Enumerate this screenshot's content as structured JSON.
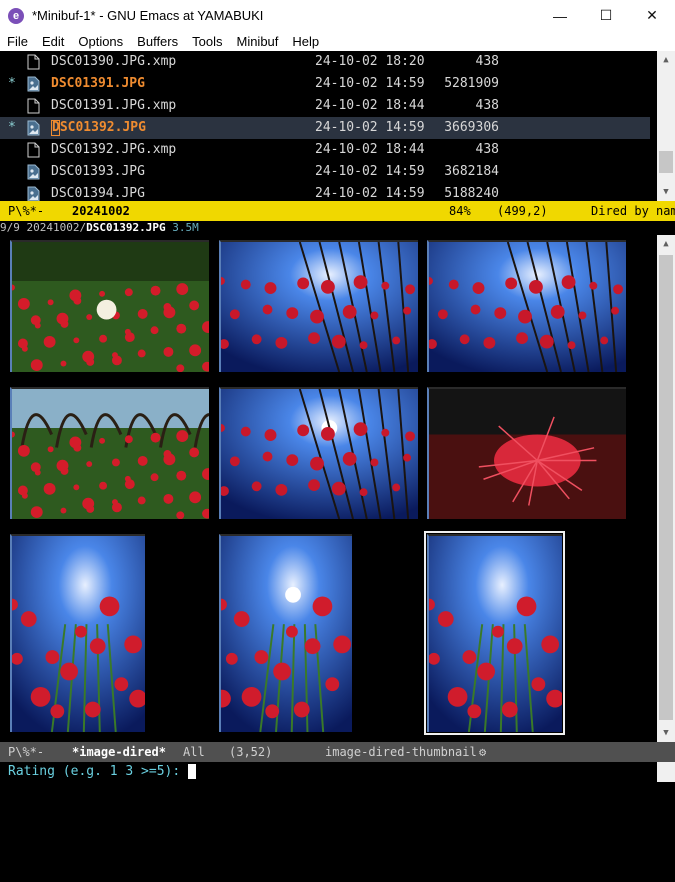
{
  "window": {
    "title": "*Minibuf-1* - GNU Emacs at YAMABUKI",
    "app_icon": "emacs-icon",
    "buttons": {
      "minimize": "—",
      "maximize": "☐",
      "close": "✕"
    }
  },
  "menu": [
    "File",
    "Edit",
    "Options",
    "Buffers",
    "Tools",
    "Minibuf",
    "Help"
  ],
  "dired": {
    "rows": [
      {
        "mark": "",
        "icon": "document-icon",
        "name": "DSC01390.JPG.xmp",
        "date": "24-10-02 18:20",
        "size": "438",
        "marked": false,
        "current": false
      },
      {
        "mark": "*",
        "icon": "image-file-icon",
        "name": "DSC01391.JPG",
        "date": "24-10-02 14:59",
        "size": "5281909",
        "marked": true,
        "current": false
      },
      {
        "mark": "",
        "icon": "document-icon",
        "name": "DSC01391.JPG.xmp",
        "date": "24-10-02 18:44",
        "size": "438",
        "marked": false,
        "current": false
      },
      {
        "mark": "*",
        "icon": "image-file-icon",
        "name": "DSC01392.JPG",
        "date": "24-10-02 14:59",
        "size": "3669306",
        "marked": true,
        "current": true
      },
      {
        "mark": "",
        "icon": "document-icon",
        "name": "DSC01392.JPG.xmp",
        "date": "24-10-02 18:44",
        "size": "438",
        "marked": false,
        "current": false
      },
      {
        "mark": "",
        "icon": "image-file-icon",
        "name": "DSC01393.JPG",
        "date": "24-10-02 14:59",
        "size": "3682184",
        "marked": false,
        "current": false
      },
      {
        "mark": "",
        "icon": "image-file-icon",
        "name": "DSC01394.JPG",
        "date": "24-10-02 14:59",
        "size": "5188240",
        "marked": false,
        "current": false
      }
    ]
  },
  "modeline_top": {
    "status": "P\\%*-",
    "buffer": "20241002",
    "percent": "84%",
    "position": "(499,2)",
    "mode": "Dired by nam"
  },
  "thumb_header": {
    "index": "9/9",
    "dir": "20241002/",
    "file": "DSC01392.JPG",
    "size": "3.5M"
  },
  "thumbnails": [
    {
      "scene": "meadow-flowers",
      "selected": false
    },
    {
      "scene": "sky-branches",
      "selected": false
    },
    {
      "scene": "sky-branches",
      "selected": false
    },
    {
      "scene": "meadow-flowers-trees",
      "selected": false
    },
    {
      "scene": "sky-sun-branches",
      "selected": false
    },
    {
      "scene": "closeup-bokeh",
      "selected": false
    },
    {
      "scene": "sky-lily-portrait",
      "selected": false
    },
    {
      "scene": "sun-lily-portrait",
      "selected": false
    },
    {
      "scene": "sky-lilies-portrait",
      "selected": true
    }
  ],
  "modeline_bottom": {
    "status": "P\\%*-",
    "buffer": "*image-dired*",
    "percent": "All",
    "position": "(3,52)",
    "mode": "image-dired-thumbnail",
    "mode_icon": "gear-icon"
  },
  "minibuffer": {
    "prompt": "Rating (e.g. 1 3 >=5): ",
    "value": ""
  },
  "colors": {
    "modeline_active": "#f0d800",
    "modeline_inactive": "#505050",
    "marked_file": "#f08c30",
    "minibuffer_prompt": "#6ad0e0"
  }
}
